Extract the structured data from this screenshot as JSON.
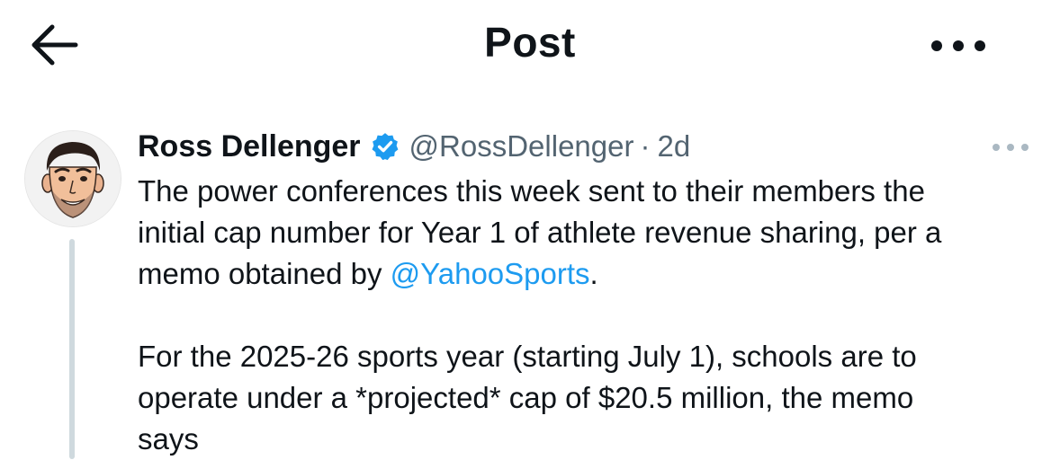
{
  "header": {
    "title": "Post",
    "back_icon": "arrow-left-icon",
    "more_icon": "more-horizontal-icon"
  },
  "tweet": {
    "author_name": "Ross Dellenger",
    "verified_icon": "verified-badge-icon",
    "handle": "@RossDellenger",
    "separator": "·",
    "time": "2d",
    "more_icon": "more-horizontal-icon",
    "line1": "The power conferences this week sent to their members the",
    "line2": "initial cap number for Year 1 of athlete revenue sharing, per a",
    "line3_prefix": "memo obtained by ",
    "mention": "@YahooSports",
    "line3_suffix": ".",
    "line4": "For the 2025-26 sports year (starting July 1), schools are to",
    "line5": "operate under a *projected* cap of $20.5 million, the memo",
    "line6": "says"
  },
  "colors": {
    "accent": "#1d9bf0",
    "text": "#0f1419",
    "secondary": "#536471",
    "thread_line": "#cfd9de"
  }
}
